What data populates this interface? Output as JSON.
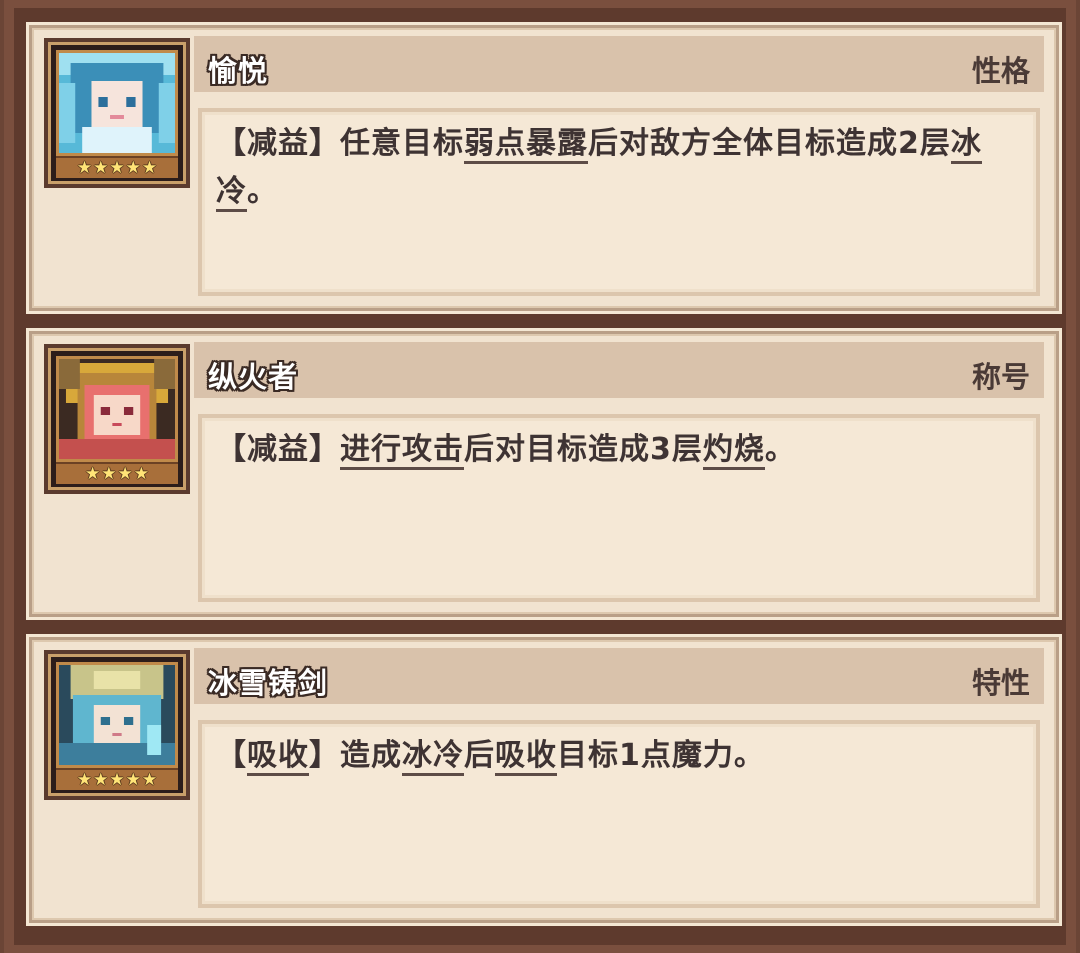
{
  "cards": [
    {
      "name": "愉悦",
      "category": "性格",
      "stars": 5,
      "desc_parts": [
        {
          "text": "【减益】任意目标",
          "underline": false
        },
        {
          "text": "弱点暴露",
          "underline": true
        },
        {
          "text": "后对敌方全体目标造成2层",
          "underline": false
        },
        {
          "text": "冰冷",
          "underline": true
        },
        {
          "text": "。",
          "underline": false
        }
      ]
    },
    {
      "name": "纵火者",
      "category": "称号",
      "stars": 4,
      "desc_parts": [
        {
          "text": "【减益】",
          "underline": false
        },
        {
          "text": "进行攻击",
          "underline": true
        },
        {
          "text": "后对目标造成3层",
          "underline": false
        },
        {
          "text": "灼烧",
          "underline": true
        },
        {
          "text": "。",
          "underline": false
        }
      ]
    },
    {
      "name": "冰雪铸剑",
      "category": "特性",
      "stars": 5,
      "desc_parts": [
        {
          "text": "【",
          "underline": false
        },
        {
          "text": "吸收",
          "underline": true
        },
        {
          "text": "】造成",
          "underline": false
        },
        {
          "text": "冰冷",
          "underline": true
        },
        {
          "text": "后",
          "underline": false
        },
        {
          "text": "吸收",
          "underline": true
        },
        {
          "text": "目标1点魔力。",
          "underline": false
        }
      ]
    }
  ],
  "colors": {
    "frame": "#6b4536",
    "card_face": "#f1e3d0",
    "title_bar": "#d9c2ab",
    "star": "#ffe477"
  }
}
